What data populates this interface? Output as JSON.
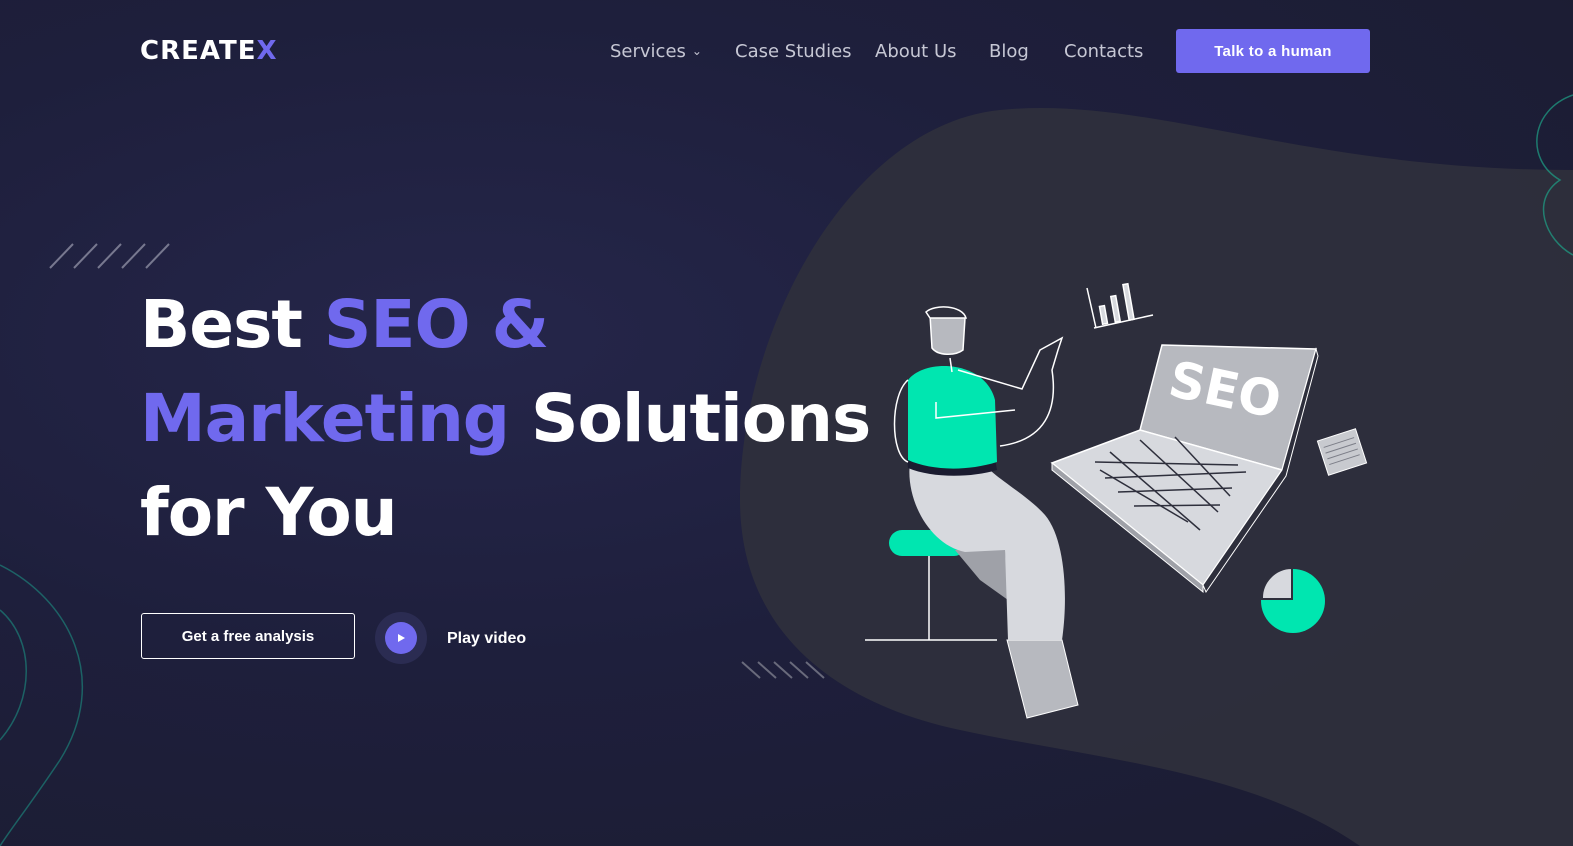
{
  "brand": {
    "logo_main": "CREATE",
    "logo_accent": "X"
  },
  "nav": {
    "items": [
      {
        "label": "Services",
        "has_dropdown": true
      },
      {
        "label": "Case Studies"
      },
      {
        "label": "About Us"
      },
      {
        "label": "Blog"
      },
      {
        "label": "Contacts"
      }
    ],
    "cta_label": "Talk to a human"
  },
  "hero": {
    "line1_white": "Best ",
    "line1_accent": "SEO &",
    "line2_accent": "Marketing",
    "line2_white": " Solutions",
    "line3_white": "for You",
    "primary_button": "Get a free analysis",
    "video_label": "Play video"
  },
  "illustration": {
    "laptop_text": "SEO"
  },
  "colors": {
    "accent": "#7069ee",
    "green": "#00e6b0",
    "background": "#1e1f3c",
    "blob": "#2d2e3b"
  }
}
